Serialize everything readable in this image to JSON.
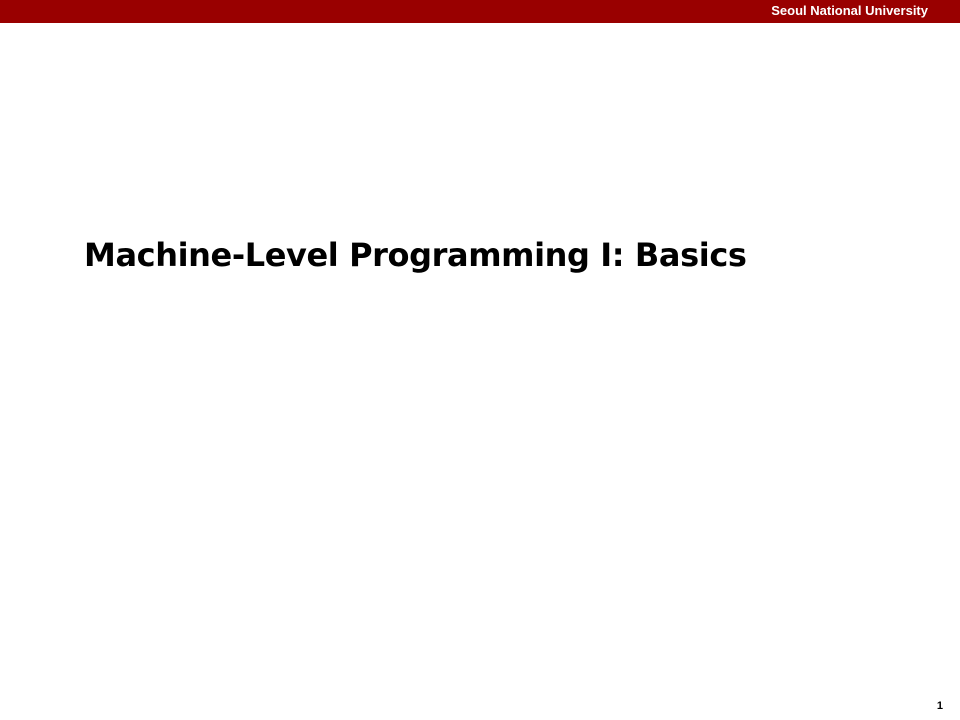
{
  "header": {
    "institution": "Seoul National University"
  },
  "slide": {
    "title": "Machine-Level Programming I: Basics",
    "page_number": "1"
  },
  "colors": {
    "header_bar": "#990000",
    "header_text": "#ffffff",
    "title_text": "#000000",
    "background": "#ffffff"
  }
}
